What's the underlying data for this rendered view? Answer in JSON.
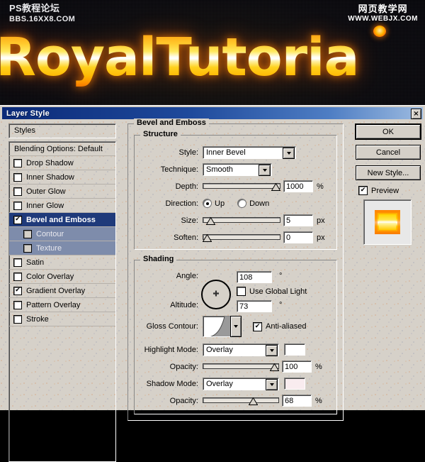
{
  "banner": {
    "watermark_left_line1": "PS教程论坛",
    "watermark_left_line2": "BBS.16XX8.COM",
    "watermark_right_line1": "网页教学网",
    "watermark_right_line2": "WWW.WEBJX.COM",
    "logo_text": "RoyalTutoria",
    "logo_color_top": "#ff8a00",
    "logo_color_mid": "#ffffff",
    "logo_color_bottom": "#e86d00",
    "background_color": "#07060a"
  },
  "dialog": {
    "title": "Layer Style",
    "close_label": "×",
    "titlebar_color": "#0b2a78",
    "face_color": "#d6d1c9"
  },
  "styles_panel": {
    "header": "Styles",
    "blending_options": "Blending Options: Default",
    "items": [
      {
        "label": "Drop Shadow",
        "checked": false,
        "selected": false,
        "sub": false
      },
      {
        "label": "Inner Shadow",
        "checked": false,
        "selected": false,
        "sub": false
      },
      {
        "label": "Outer Glow",
        "checked": false,
        "selected": false,
        "sub": false
      },
      {
        "label": "Inner Glow",
        "checked": false,
        "selected": false,
        "sub": false
      },
      {
        "label": "Bevel and Emboss",
        "checked": true,
        "selected": true,
        "sub": false
      },
      {
        "label": "Contour",
        "checked": false,
        "selected": false,
        "sub": true
      },
      {
        "label": "Texture",
        "checked": false,
        "selected": false,
        "sub": true
      },
      {
        "label": "Satin",
        "checked": false,
        "selected": false,
        "sub": false
      },
      {
        "label": "Color Overlay",
        "checked": false,
        "selected": false,
        "sub": false
      },
      {
        "label": "Gradient Overlay",
        "checked": true,
        "selected": false,
        "sub": false
      },
      {
        "label": "Pattern Overlay",
        "checked": false,
        "selected": false,
        "sub": false
      },
      {
        "label": "Stroke",
        "checked": false,
        "selected": false,
        "sub": false
      }
    ],
    "check_glyph": "✔"
  },
  "bevel": {
    "group_title": "Bevel and Emboss",
    "structure": {
      "title": "Structure",
      "style_label": "Style:",
      "style_value": "Inner Bevel",
      "technique_label": "Technique:",
      "technique_value": "Smooth",
      "depth_label": "Depth:",
      "depth_value": "1000",
      "depth_unit": "%",
      "depth_percent": 100,
      "direction_label": "Direction:",
      "direction_up": "Up",
      "direction_down": "Down",
      "direction_selected": "Up",
      "size_label": "Size:",
      "size_value": "5",
      "size_unit": "px",
      "size_percent": 5,
      "soften_label": "Soften:",
      "soften_value": "0",
      "soften_unit": "px",
      "soften_percent": 0
    },
    "shading": {
      "title": "Shading",
      "angle_label": "Angle:",
      "angle_value": "108",
      "angle_unit": "°",
      "use_global_light": "Use Global Light",
      "use_global_light_checked": false,
      "altitude_label": "Altitude:",
      "altitude_value": "73",
      "altitude_unit": "°",
      "gloss_contour_label": "Gloss Contour:",
      "anti_aliased": "Anti-aliased",
      "anti_aliased_checked": true,
      "highlight_mode_label": "Highlight Mode:",
      "highlight_mode_value": "Overlay",
      "highlight_color": "#ffffff",
      "highlight_opacity_label": "Opacity:",
      "highlight_opacity_value": "100",
      "highlight_opacity_unit": "%",
      "highlight_opacity_percent": 100,
      "shadow_mode_label": "Shadow Mode:",
      "shadow_mode_value": "Overlay",
      "shadow_color": "#f9ecef",
      "shadow_opacity_label": "Opacity:",
      "shadow_opacity_value": "68",
      "shadow_opacity_unit": "%",
      "shadow_opacity_percent": 68
    }
  },
  "buttons": {
    "ok": "OK",
    "cancel": "Cancel",
    "new_style": "New Style...",
    "preview": "Preview",
    "preview_checked": true
  }
}
